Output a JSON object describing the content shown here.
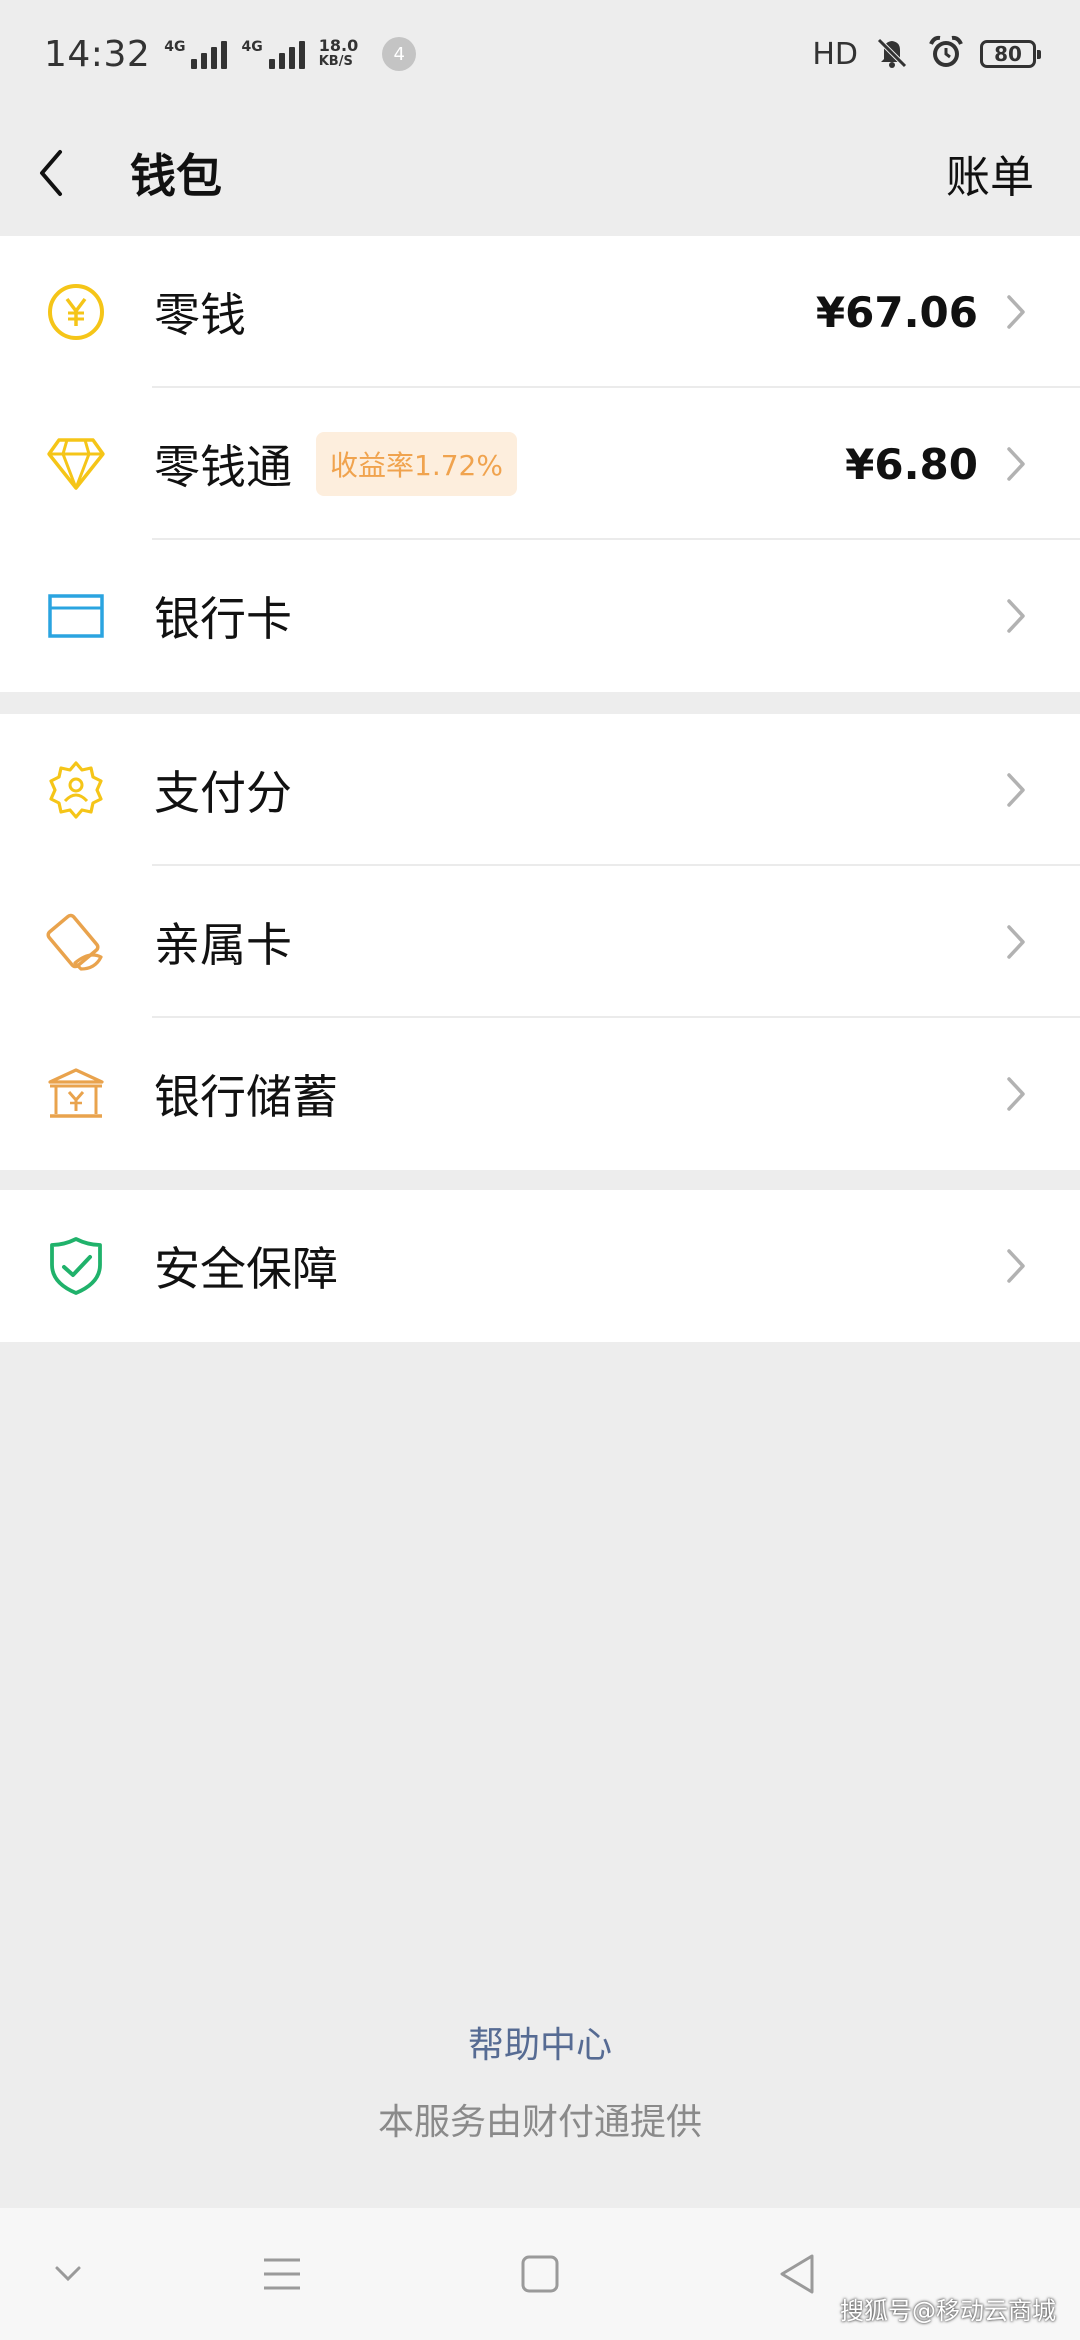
{
  "status_bar": {
    "time": "14:32",
    "network_1": "4G",
    "network_2": "4G",
    "speed_value": "18.0",
    "speed_unit": "KB/S",
    "notification_count": "4",
    "hd_label": "HD",
    "battery": "80"
  },
  "header": {
    "title": "钱包",
    "bill_label": "账单"
  },
  "groups": [
    {
      "items": [
        {
          "label": "零钱",
          "value": "¥67.06",
          "icon": "yuan-coin-icon"
        },
        {
          "label": "零钱通",
          "badge": "收益率1.72%",
          "value": "¥6.80",
          "icon": "diamond-icon"
        },
        {
          "label": "银行卡",
          "icon": "bank-card-icon"
        }
      ]
    },
    {
      "items": [
        {
          "label": "支付分",
          "icon": "pay-score-icon"
        },
        {
          "label": "亲属卡",
          "icon": "family-card-icon"
        },
        {
          "label": "银行储蓄",
          "icon": "bank-savings-icon"
        }
      ]
    },
    {
      "items": [
        {
          "label": "安全保障",
          "icon": "shield-check-icon"
        }
      ]
    }
  ],
  "footer": {
    "help_center": "帮助中心",
    "provider": "本服务由财付通提供"
  },
  "watermark": "搜狐号@移动云商城",
  "colors": {
    "background": "#ededed",
    "card": "#ffffff",
    "yellow_icon": "#f5c518",
    "orange_icon": "#e9a34d",
    "blue_icon": "#2aa4e0",
    "green_icon": "#20b26b",
    "link": "#566b93",
    "badge_bg": "#fdeedd",
    "badge_text": "#f0a34e"
  }
}
